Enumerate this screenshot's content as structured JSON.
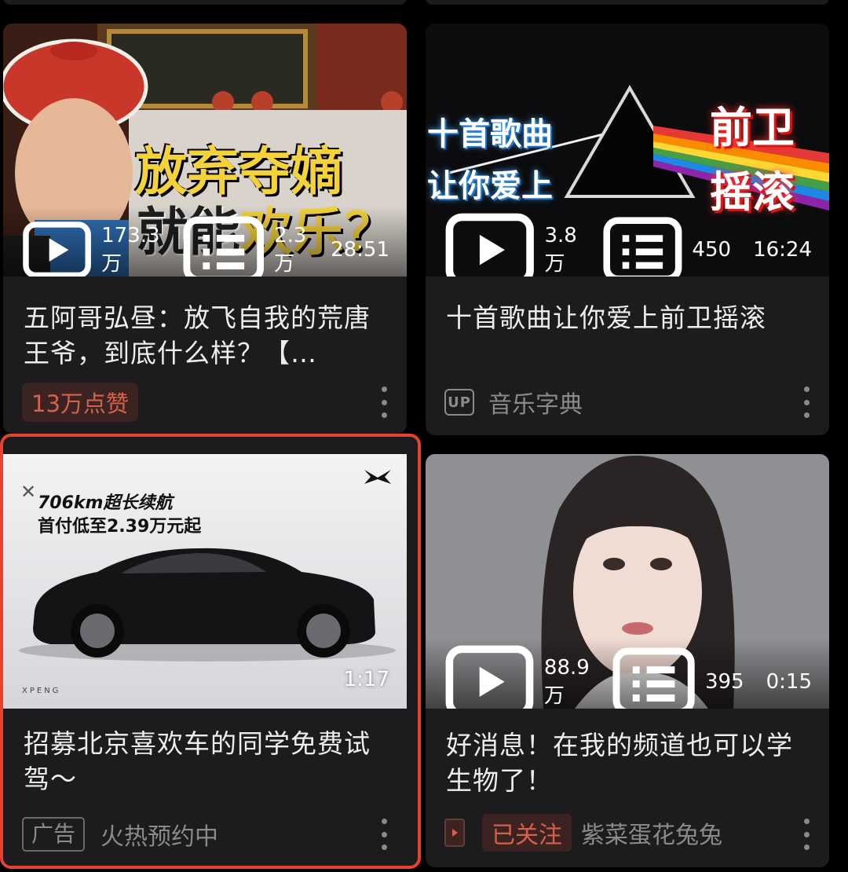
{
  "cards": [
    {
      "thumb_text": {
        "line1": "放弃夺嫡",
        "line2_a": "就能",
        "line2_b": "欢乐",
        "line2_c": "？"
      },
      "views": "173.3万",
      "comments": "2.3万",
      "duration": "28:51",
      "title": "五阿哥弘昼：放飞自我的荒唐王爷，到底什么样？【…",
      "badge": "13万点赞"
    },
    {
      "thumb_text": {
        "left1": "十首歌曲",
        "left2": "让你爱上",
        "right1": "前卫",
        "right2": "摇滚"
      },
      "views": "3.8万",
      "comments": "450",
      "duration": "16:24",
      "title": "十首歌曲让你爱上前卫摇滚",
      "up_label": "UP",
      "author": "音乐字典"
    },
    {
      "thumb_text": {
        "line1": "706km超长续航",
        "line2": "首付低至2.39万元起",
        "brand": "XPENG"
      },
      "duration": "1:17",
      "title": "招募北京喜欢车的同学免费试驾～",
      "ad_label": "广告",
      "author": "火热预约中"
    },
    {
      "views": "88.9万",
      "comments": "395",
      "duration": "0:15",
      "title": "好消息！在我的频道也可以学生物了！",
      "follow_label": "已关注",
      "author": "紫菜蛋花兔兔"
    }
  ],
  "colors": {
    "background": "#000000",
    "card": "#1c1c1e",
    "accent": "#e5432f",
    "badge_text": "#d5614d"
  },
  "icons": [
    "play-count-icon",
    "danmaku-icon",
    "more-icon",
    "close-icon",
    "xpeng-logo-icon",
    "channel-icon"
  ]
}
